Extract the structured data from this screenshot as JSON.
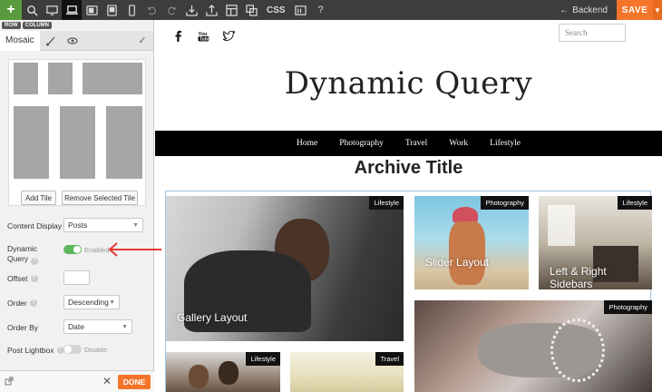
{
  "toolbar": {
    "add_icon": "plus-icon",
    "icons": [
      "zoom-icon",
      "desktop-icon",
      "laptop-icon",
      "tablet-landscape-icon",
      "tablet-portrait-icon",
      "phone-icon",
      "undo-icon",
      "redo-icon",
      "import-icon",
      "export-icon",
      "layout-icon",
      "copy-icon"
    ],
    "css_label": "CSS",
    "backend_label": "Backend",
    "save_label": "SAVE"
  },
  "panel": {
    "crumbs": [
      "ROW",
      "COLUMN"
    ],
    "tab_label": "Mosaic",
    "buttons": {
      "add_tile": "Add Tile",
      "remove_tile": "Remove Selected Tile"
    },
    "fields": {
      "content_display": {
        "label": "Content Display",
        "value": "Posts"
      },
      "dynamic_query": {
        "label_line1": "Dynamic",
        "label_line2": "Query",
        "state": "Enabled",
        "on": true
      },
      "offset": {
        "label": "Offset",
        "value": ""
      },
      "order": {
        "label": "Order",
        "value": "Descending"
      },
      "order_by": {
        "label": "Order By",
        "value": "Date"
      },
      "post_lightbox": {
        "label": "Post Lightbox",
        "state": "Disable",
        "on": false
      }
    },
    "footer": {
      "done_label": "DONE"
    }
  },
  "site": {
    "search_placeholder": "Search",
    "title": "Dynamic Query",
    "nav": [
      "Home",
      "Photography",
      "Travel",
      "Work",
      "Lifestyle"
    ],
    "archive_title": "Archive Title",
    "tiles": [
      {
        "category": "Lifestyle",
        "title": "Gallery Layout"
      },
      {
        "category": "Photography",
        "title": "Slider Layout"
      },
      {
        "category": "Lifestyle",
        "title_line1": "Left & Right",
        "title_line2": "Sidebars"
      },
      {
        "category": "Photography",
        "title": ""
      },
      {
        "category": "Lifestyle",
        "title": ""
      },
      {
        "category": "Travel",
        "title": ""
      }
    ]
  },
  "colors": {
    "accent": "#f5762a",
    "toggle_on": "#5cb85c",
    "annotation_arrow": "#e53935"
  }
}
